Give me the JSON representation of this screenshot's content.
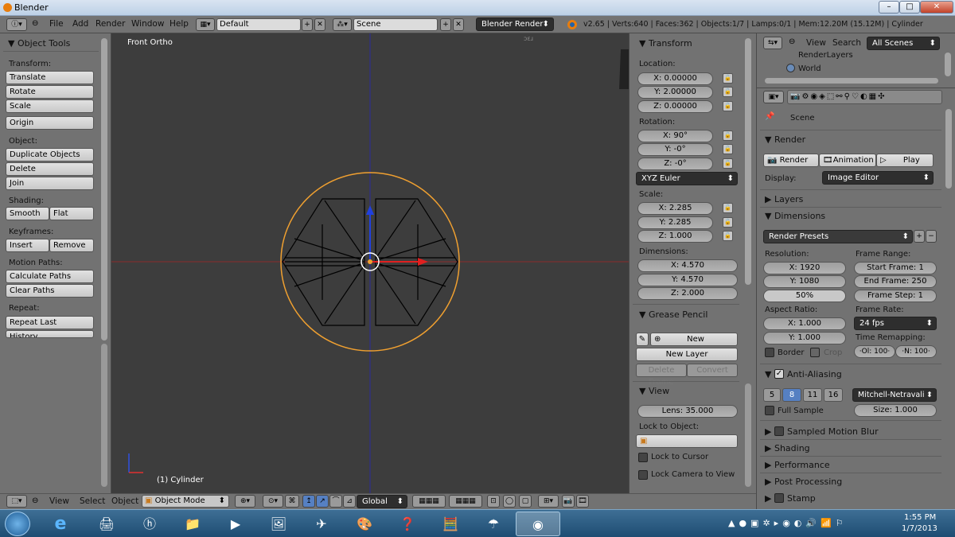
{
  "window": {
    "title": "Blender",
    "buttons": [
      "–",
      "□",
      "✕"
    ]
  },
  "infobar": {
    "menus": [
      "File",
      "Add",
      "Render",
      "Window",
      "Help"
    ],
    "layout": "Default",
    "scene": "Scene",
    "engine": "Blender Render",
    "stats": "v2.65 | Verts:640 | Faces:362 | Objects:1/7 | Lamps:0/1 | Mem:12.20M (15.12M) | Cylinder"
  },
  "tools": {
    "header": "▼ Object Tools",
    "transform_label": "Transform:",
    "translate": "Translate",
    "rotate": "Rotate",
    "scale": "Scale",
    "origin": "Origin",
    "object_label": "Object:",
    "duplicate": "Duplicate Objects",
    "delete": "Delete",
    "join": "Join",
    "shading_label": "Shading:",
    "smooth": "Smooth",
    "flat": "Flat",
    "keyframes_label": "Keyframes:",
    "insert": "Insert",
    "remove": "Remove",
    "motion_label": "Motion Paths:",
    "calc_paths": "Calculate Paths",
    "clear_paths": "Clear Paths",
    "repeat_label": "Repeat:",
    "repeat_last": "Repeat Last",
    "history": "History..."
  },
  "viewport": {
    "view_name": "Front Ortho",
    "object_name": "(1) Cylinder",
    "corner": "ɔɛɹ"
  },
  "properties": {
    "transform_header": "▼ Transform",
    "location_label": "Location:",
    "loc": [
      "X: 0.00000",
      "Y: 2.00000",
      "Z: 0.00000"
    ],
    "rotation_label": "Rotation:",
    "rot": [
      "X: 90°",
      "Y: -0°",
      "Z: -0°"
    ],
    "rot_mode": "XYZ Euler",
    "scale_label": "Scale:",
    "scale": [
      "X: 2.285",
      "Y: 2.285",
      "Z: 1.000"
    ],
    "dimensions_label": "Dimensions:",
    "dims": [
      "X: 4.570",
      "Y: 4.570",
      "Z: 2.000"
    ],
    "grease_header": "▼ Grease Pencil",
    "gp_new": "New",
    "gp_new_layer": "New Layer",
    "gp_delete_frame": "Delete Frame",
    "gp_convert": "Convert",
    "view_header": "▼ View",
    "lens": "Lens: 35.000",
    "lock_obj_label": "Lock to Object:",
    "lock_cursor": "Lock to Cursor",
    "lock_camera": "Lock Camera to View"
  },
  "outliner": {
    "view": "View",
    "search": "Search",
    "filter": "All Scenes",
    "items": [
      "RenderLayers",
      "World"
    ]
  },
  "render": {
    "scene": "Scene",
    "render_header": "▼ Render",
    "render_btn": "Render",
    "animation_btn": "Animation",
    "play_btn": "Play",
    "display_label": "Display:",
    "display_value": "Image Editor",
    "layers": "▶ Layers",
    "dimensions": "▼ Dimensions",
    "presets": "Render Presets",
    "resolution_label": "Resolution:",
    "res_x": "X: 1920",
    "res_y": "Y: 1080",
    "res_pct": "50%",
    "frame_range_label": "Frame Range:",
    "start": "Start Frame: 1",
    "end": "End Frame: 250",
    "step": "Frame Step: 1",
    "aspect_label": "Aspect Ratio:",
    "asp_x": "X: 1.000",
    "asp_y": "Y: 1.000",
    "frame_rate_label": "Frame Rate:",
    "fps": "24 fps",
    "remap_label": "Time Remapping:",
    "remap_old": "·Ol: 100·",
    "remap_new": "·N: 100·",
    "border": "Border",
    "crop": "Crop",
    "aa_header": "Anti-Aliasing",
    "aa_samples": [
      "5",
      "8",
      "11",
      "16"
    ],
    "aa_filter": "Mitchell-Netravali",
    "full_sample": "Full Sample",
    "size": "Size: 1.000",
    "motion_blur": "Sampled Motion Blur",
    "shading": "▶ Shading",
    "performance": "▶ Performance",
    "post": "▶ Post Processing",
    "stamp": "Stamp"
  },
  "bottom": {
    "view": "View",
    "select": "Select",
    "object": "Object",
    "mode": "Object Mode",
    "orientation": "Global"
  },
  "taskbar": {
    "time": "1:55 PM",
    "date": "1/7/2013"
  },
  "colors": {
    "selection": "#f0a030",
    "x_axis": "#c03030",
    "z_axis": "#3030c0"
  }
}
